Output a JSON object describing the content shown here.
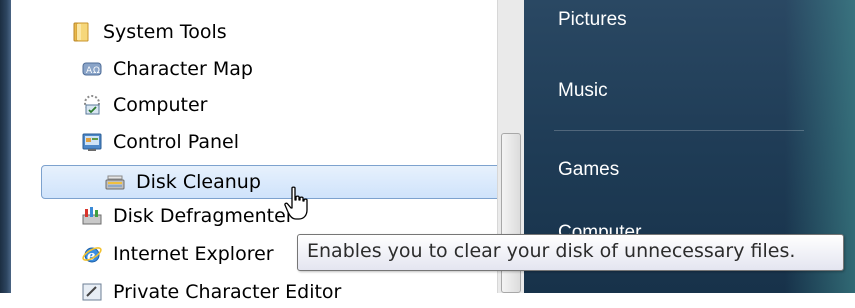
{
  "programs": {
    "folder": {
      "label": "System Tools",
      "icon": "folder-icon"
    },
    "items": [
      {
        "label": "Character Map",
        "icon": "character-map-icon"
      },
      {
        "label": "Computer",
        "icon": "computer-icon"
      },
      {
        "label": "Control Panel",
        "icon": "control-panel-icon"
      },
      {
        "label": "Disk Cleanup",
        "icon": "disk-cleanup-icon",
        "selected": true
      },
      {
        "label": "Disk Defragmenter",
        "icon": "disk-defragmenter-icon"
      },
      {
        "label": "Internet Explorer",
        "icon": "internet-explorer-icon"
      },
      {
        "label": "Private Character Editor",
        "icon": "private-character-editor-icon"
      }
    ]
  },
  "right_pane": {
    "items": [
      "Pictures",
      "Music",
      "Games",
      "Computer"
    ]
  },
  "tooltip": {
    "text": "Enables you to clear your disk of unnecessary files."
  },
  "colors": {
    "selection_border": "#7da2ce",
    "right_pane": "#1f3c56",
    "tooltip_border": "#767676"
  }
}
